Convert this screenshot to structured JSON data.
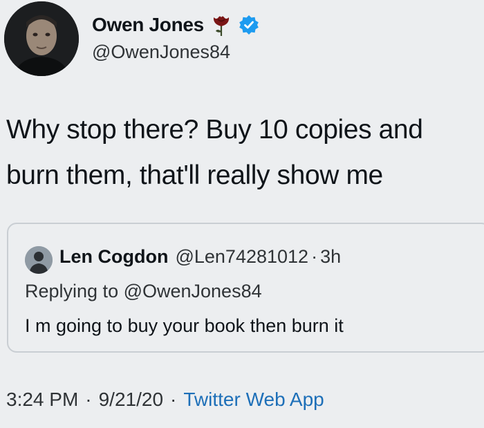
{
  "author": {
    "display_name": "Owen Jones",
    "handle": "@OwenJones84",
    "avatar_icon": "profile-photo",
    "rose_icon": "red-rose-emoji",
    "verified_icon": "verified-badge",
    "verified_color": "#1d9bf0"
  },
  "tweet": {
    "text": "Why stop there? Buy 10 copies and burn them, that'll really show me"
  },
  "quoted_tweet": {
    "display_name": "Len Cogdon",
    "handle": "@Len74281012",
    "separator": "·",
    "time_ago": "3h",
    "replying_to": "Replying to @OwenJones84",
    "text": "I m going to buy your book then burn it",
    "avatar_icon": "default-avatar"
  },
  "meta": {
    "time": "3:24 PM",
    "separator": "·",
    "date": "9/21/20",
    "source": "Twitter Web App",
    "source_color": "#1d6fb8"
  }
}
